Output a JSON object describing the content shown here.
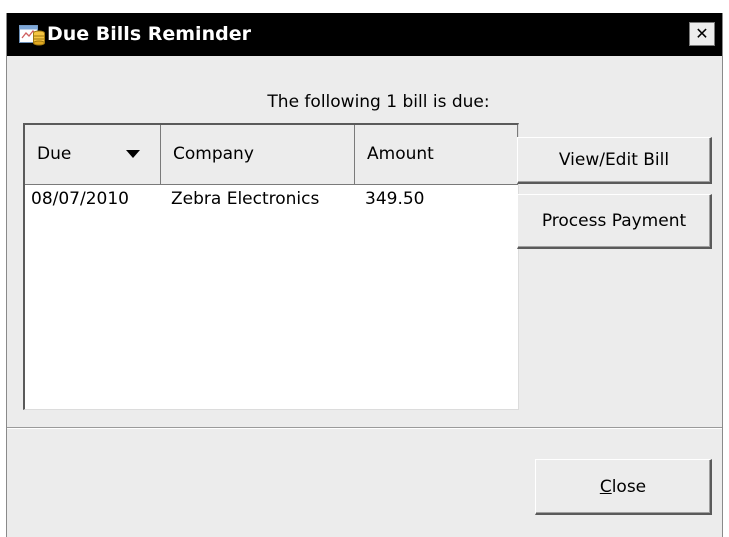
{
  "window": {
    "title": "Due Bills Reminder",
    "close_glyph": "✕"
  },
  "message": "The following 1 bill is due:",
  "table": {
    "columns": [
      "Due",
      "Company",
      "Amount"
    ],
    "sort_column": "Due",
    "rows": [
      {
        "due": "08/07/2010",
        "company": "Zebra Electronics",
        "amount": "349.50"
      }
    ]
  },
  "buttons": {
    "view_edit": "View/Edit Bill",
    "process_payment": "Process Payment",
    "close_mnemonic": "C",
    "close_rest": "lose"
  },
  "icons": {
    "app": "bills-calendar-coins-icon",
    "sort": "sort-descending-icon",
    "close": "close-icon"
  },
  "colors": {
    "titlebar": "#000000",
    "dialog_bg": "#ececec",
    "table_bg": "#ffffff"
  }
}
